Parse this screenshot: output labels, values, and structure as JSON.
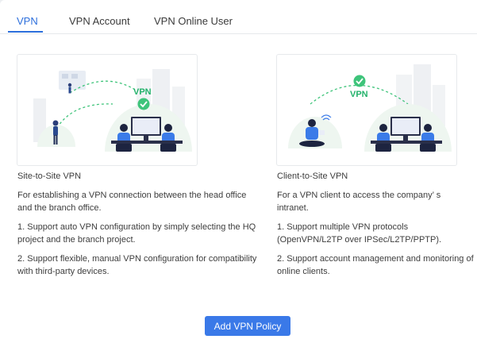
{
  "tabs": [
    {
      "label": "VPN",
      "active": true
    },
    {
      "label": "VPN Account",
      "active": false
    },
    {
      "label": "VPN Online User",
      "active": false
    }
  ],
  "illustrations": {
    "site_badge": "VPN",
    "client_badge": "VPN"
  },
  "site_to_site": {
    "title": "Site-to-Site VPN",
    "description": "For establishing a VPN connection between the head office and the branch office.",
    "points": [
      "1. Support auto VPN configuration by simply selecting the HQ project and the branch project.",
      "2. Support flexible, manual VPN configuration for compatibility with third-party devices."
    ]
  },
  "client_to_site": {
    "title": "Client-to-Site VPN",
    "description": "For a VPN client to access the company’ s intranet.",
    "points": [
      "1. Support multiple VPN protocols (OpenVPN/L2TP over IPSec/L2TP/PPTP).",
      "2. Support account management and monitoring of online clients."
    ]
  },
  "actions": {
    "add_label": "Add VPN Policy"
  },
  "colors": {
    "accent": "#2d6fdc",
    "button": "#3a79e8",
    "check": "#3ec47a",
    "vpn_text": "#23b26b"
  }
}
